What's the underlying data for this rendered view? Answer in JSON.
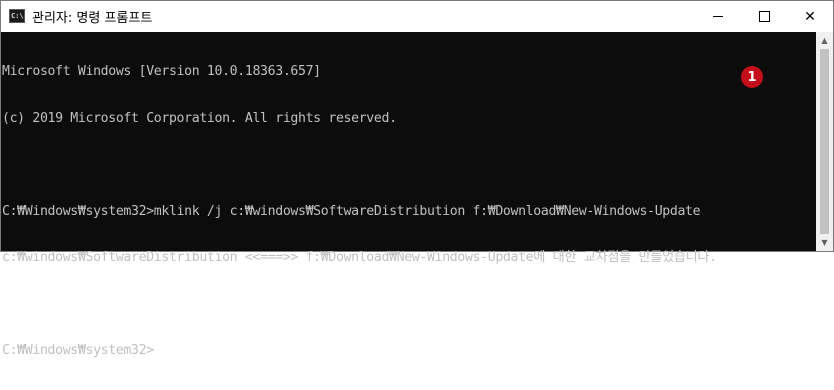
{
  "window": {
    "title": "관리자: 명령 프롬프트",
    "icon": "console-app-icon",
    "icon_glyph": "C:\\"
  },
  "controls": {
    "minimize": "minimize-icon",
    "maximize": "maximize-icon",
    "close_glyph": "✕"
  },
  "console": {
    "lines": [
      "Microsoft Windows [Version 10.0.18363.657]",
      "(c) 2019 Microsoft Corporation. All rights reserved.",
      "",
      "C:₩Windows₩system32>mklink /j c:₩windows₩SoftwareDistribution f:₩Download₩New-Windows-Update",
      "c:₩windows₩SoftwareDistribution <<===>> f:₩Download₩New-Windows-Update에 대한 교차점을 만들었습니다.",
      "",
      "C:₩Windows₩system32>"
    ]
  },
  "annotation": {
    "badge": "1",
    "color": "#c40f1a"
  },
  "scrollbar": {
    "up_glyph": "▲",
    "down_glyph": "▼"
  }
}
